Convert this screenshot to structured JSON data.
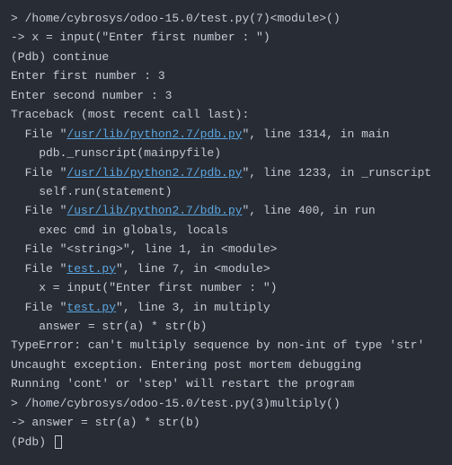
{
  "terminal": {
    "lines": [
      {
        "segments": [
          {
            "t": "> /home/cybrosys/odoo-15.0/test.py(7)<module>()",
            "link": false
          }
        ]
      },
      {
        "segments": [
          {
            "t": "-> x = input(\"Enter first number : \")",
            "link": false
          }
        ]
      },
      {
        "segments": [
          {
            "t": "(Pdb) continue",
            "link": false
          }
        ]
      },
      {
        "segments": [
          {
            "t": "Enter first number : 3",
            "link": false
          }
        ]
      },
      {
        "segments": [
          {
            "t": "Enter second number : 3",
            "link": false
          }
        ]
      },
      {
        "segments": [
          {
            "t": "Traceback (most recent call last):",
            "link": false
          }
        ]
      },
      {
        "segments": [
          {
            "t": "  File \"",
            "link": false
          },
          {
            "t": "/usr/lib/python2.7/pdb.py",
            "link": true
          },
          {
            "t": "\", line 1314, in main",
            "link": false
          }
        ]
      },
      {
        "segments": [
          {
            "t": "    pdb._runscript(mainpyfile)",
            "link": false
          }
        ]
      },
      {
        "segments": [
          {
            "t": "  File \"",
            "link": false
          },
          {
            "t": "/usr/lib/python2.7/pdb.py",
            "link": true
          },
          {
            "t": "\", line 1233, in _runscript",
            "link": false
          }
        ]
      },
      {
        "segments": [
          {
            "t": "    self.run(statement)",
            "link": false
          }
        ]
      },
      {
        "segments": [
          {
            "t": "  File \"",
            "link": false
          },
          {
            "t": "/usr/lib/python2.7/bdb.py",
            "link": true
          },
          {
            "t": "\", line 400, in run",
            "link": false
          }
        ]
      },
      {
        "segments": [
          {
            "t": "    exec cmd in globals, locals",
            "link": false
          }
        ]
      },
      {
        "segments": [
          {
            "t": "  File \"<string>\", line 1, in <module>",
            "link": false
          }
        ]
      },
      {
        "segments": [
          {
            "t": "  File \"",
            "link": false
          },
          {
            "t": "test.py",
            "link": true
          },
          {
            "t": "\", line 7, in <module>",
            "link": false
          }
        ]
      },
      {
        "segments": [
          {
            "t": "    x = input(\"Enter first number : \")",
            "link": false
          }
        ]
      },
      {
        "segments": [
          {
            "t": "  File \"",
            "link": false
          },
          {
            "t": "test.py",
            "link": true
          },
          {
            "t": "\", line 3, in multiply",
            "link": false
          }
        ]
      },
      {
        "segments": [
          {
            "t": "    answer = str(a) * str(b)",
            "link": false
          }
        ]
      },
      {
        "segments": [
          {
            "t": "TypeError: can't multiply sequence by non-int of type 'str'",
            "link": false
          }
        ]
      },
      {
        "segments": [
          {
            "t": "Uncaught exception. Entering post mortem debugging",
            "link": false
          }
        ]
      },
      {
        "segments": [
          {
            "t": "Running 'cont' or 'step' will restart the program",
            "link": false
          }
        ]
      },
      {
        "segments": [
          {
            "t": "> /home/cybrosys/odoo-15.0/test.py(3)multiply()",
            "link": false
          }
        ]
      },
      {
        "segments": [
          {
            "t": "-> answer = str(a) * str(b)",
            "link": false
          }
        ]
      },
      {
        "segments": [
          {
            "t": "(Pdb) ",
            "link": false
          }
        ],
        "cursor": true
      }
    ]
  }
}
